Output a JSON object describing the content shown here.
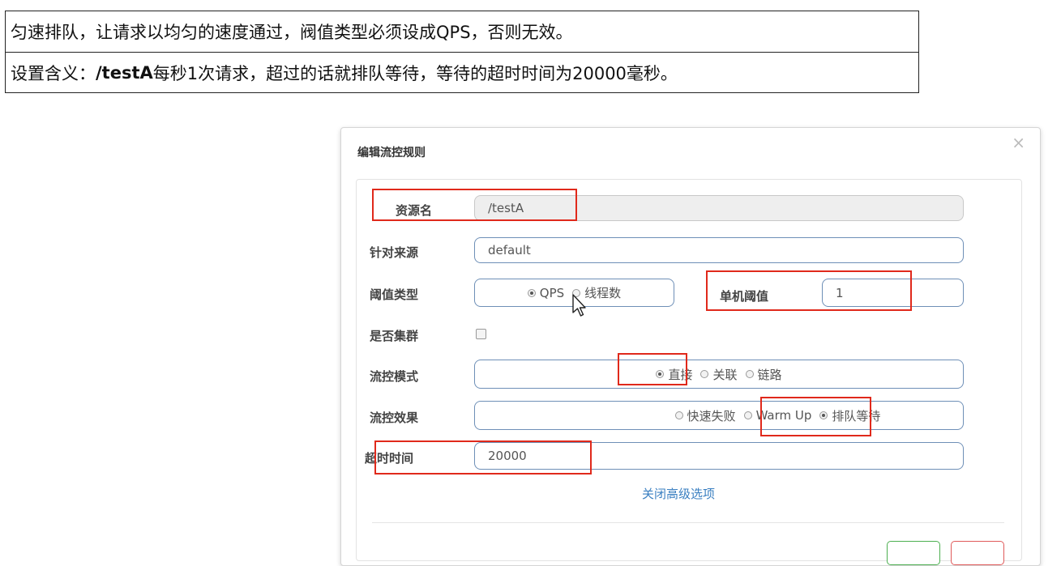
{
  "notes": {
    "row1": "匀速排队，让请求以均匀的速度通过，阀值类型必须设成QPS，否则无效。",
    "row2_prefix": "设置含义：",
    "row2_bold": "/testA",
    "row2_rest": "每秒1次请求，超过的话就排队等待，等待的超时时间为20000毫秒。"
  },
  "modal": {
    "title": "编辑流控规则",
    "close": "×",
    "resource_label": "资源名",
    "resource_value": "/testA",
    "source_label": "针对来源",
    "source_value": "default",
    "threshold_type_label": "阈值类型",
    "threshold_options": [
      "QPS",
      "线程数"
    ],
    "threshold_selected": "QPS",
    "single_threshold_label": "单机阈值",
    "single_threshold_value": "1",
    "cluster_label": "是否集群",
    "cluster_checked": false,
    "mode_label": "流控模式",
    "mode_options": [
      "直接",
      "关联",
      "链路"
    ],
    "mode_selected": "直接",
    "effect_label": "流控效果",
    "effect_options": [
      "快速失败",
      "Warm Up",
      "排队等待"
    ],
    "effect_selected": "排队等待",
    "timeout_label": "超时时间",
    "timeout_value": "20000",
    "advanced_link": "关闭高级选项"
  },
  "colors": {
    "highlight": "#e0291b",
    "field_border": "#6e8fb7",
    "link": "#3a7fc1",
    "ok_button": "#4caf50",
    "cancel_button": "#e05a5a"
  },
  "icons": [
    "close-icon",
    "mouse-cursor-icon"
  ]
}
